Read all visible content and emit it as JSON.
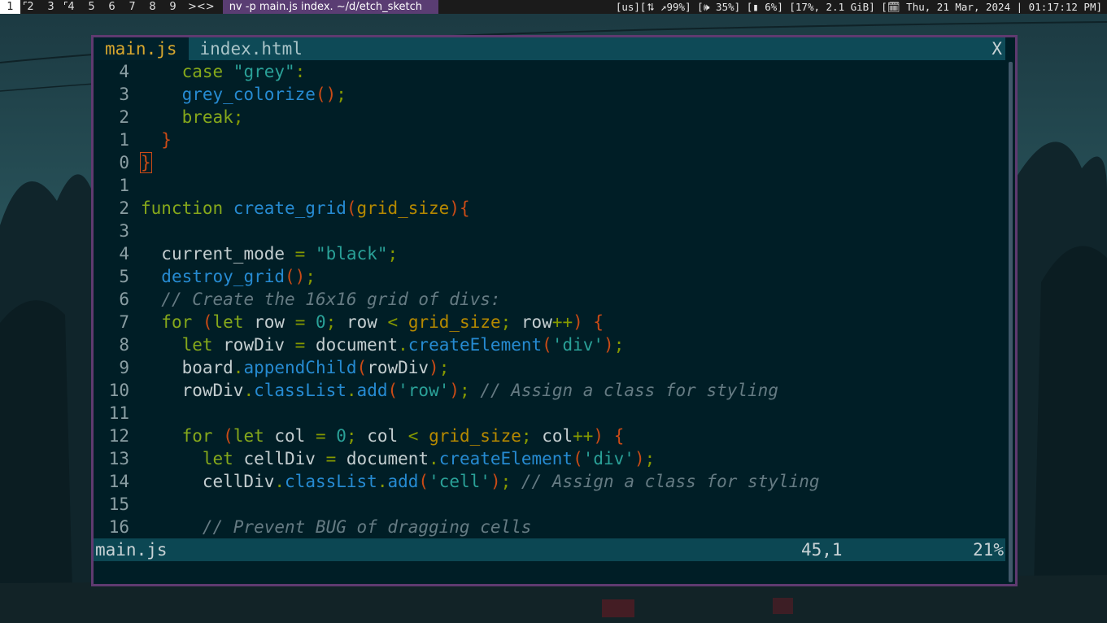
{
  "topbar": {
    "workspaces": [
      "1",
      "2",
      "3",
      "4",
      "5",
      "6",
      "7",
      "8",
      "9"
    ],
    "active_workspace": "1",
    "layout_symbol": "><>",
    "window_title": "nv -p main.js index. ~/d/etch_sketch",
    "status_text": "[us][⮁ ↗99%] [🕪 35%] [▮ 6%] [17%, 2.1 GiB] [🗓 Thu, 21 Mar, 2024 | 01:17:12 PM]"
  },
  "tabs": [
    {
      "label": "main.js",
      "active": true
    },
    {
      "label": "index.html",
      "active": false
    }
  ],
  "tab_close_label": "X",
  "code_lines": [
    {
      "num": "4",
      "indent": 4,
      "tokens": [
        [
          "kw",
          "case "
        ],
        [
          "str",
          "\"grey\""
        ],
        [
          "op",
          ":"
        ]
      ]
    },
    {
      "num": "3",
      "indent": 4,
      "tokens": [
        [
          "fn",
          "grey_colorize"
        ],
        [
          "par",
          "()"
        ],
        [
          "op",
          ";"
        ]
      ]
    },
    {
      "num": "2",
      "indent": 4,
      "tokens": [
        [
          "kw",
          "break"
        ],
        [
          "op",
          ";"
        ]
      ]
    },
    {
      "num": "1",
      "indent": 2,
      "tokens": [
        [
          "par",
          "}"
        ]
      ]
    },
    {
      "num": "0",
      "indent": 0,
      "tokens": [
        [
          "par",
          "}"
        ]
      ],
      "cursor": true
    },
    {
      "num": "1",
      "indent": 0,
      "tokens": []
    },
    {
      "num": "2",
      "indent": 0,
      "tokens": [
        [
          "kw",
          "function "
        ],
        [
          "fn",
          "create_grid"
        ],
        [
          "par",
          "("
        ],
        [
          "var",
          "grid_size"
        ],
        [
          "par",
          "){"
        ]
      ]
    },
    {
      "num": "3",
      "indent": 0,
      "tokens": []
    },
    {
      "num": "4",
      "indent": 2,
      "tokens": [
        [
          "plain",
          "current_mode "
        ],
        [
          "op",
          "= "
        ],
        [
          "str",
          "\"black\""
        ],
        [
          "op",
          ";"
        ]
      ]
    },
    {
      "num": "5",
      "indent": 2,
      "tokens": [
        [
          "fn",
          "destroy_grid"
        ],
        [
          "par",
          "()"
        ],
        [
          "op",
          ";"
        ]
      ]
    },
    {
      "num": "6",
      "indent": 2,
      "tokens": [
        [
          "cm",
          "// Create the 16x16 grid of divs:"
        ]
      ]
    },
    {
      "num": "7",
      "indent": 2,
      "tokens": [
        [
          "kw",
          "for "
        ],
        [
          "par",
          "("
        ],
        [
          "kw",
          "let "
        ],
        [
          "plain",
          "row "
        ],
        [
          "op",
          "= "
        ],
        [
          "num",
          "0"
        ],
        [
          "op",
          "; "
        ],
        [
          "plain",
          "row "
        ],
        [
          "op",
          "< "
        ],
        [
          "var",
          "grid_size"
        ],
        [
          "op",
          "; "
        ],
        [
          "plain",
          "row"
        ],
        [
          "op",
          "++"
        ],
        [
          "par",
          ") {"
        ]
      ]
    },
    {
      "num": "8",
      "indent": 4,
      "tokens": [
        [
          "kw",
          "let "
        ],
        [
          "plain",
          "rowDiv "
        ],
        [
          "op",
          "= "
        ],
        [
          "plain",
          "document"
        ],
        [
          "op",
          "."
        ],
        [
          "fn",
          "createElement"
        ],
        [
          "par",
          "("
        ],
        [
          "str",
          "'div'"
        ],
        [
          "par",
          ")"
        ],
        [
          "op",
          ";"
        ]
      ]
    },
    {
      "num": "9",
      "indent": 4,
      "tokens": [
        [
          "plain",
          "board"
        ],
        [
          "op",
          "."
        ],
        [
          "fn",
          "appendChild"
        ],
        [
          "par",
          "("
        ],
        [
          "plain",
          "rowDiv"
        ],
        [
          "par",
          ")"
        ],
        [
          "op",
          ";"
        ]
      ]
    },
    {
      "num": "10",
      "indent": 4,
      "tokens": [
        [
          "plain",
          "rowDiv"
        ],
        [
          "op",
          "."
        ],
        [
          "fn",
          "classList"
        ],
        [
          "op",
          "."
        ],
        [
          "fn",
          "add"
        ],
        [
          "par",
          "("
        ],
        [
          "str",
          "'row'"
        ],
        [
          "par",
          ")"
        ],
        [
          "op",
          "; "
        ],
        [
          "cm",
          "// Assign a class for styling"
        ]
      ]
    },
    {
      "num": "11",
      "indent": 0,
      "tokens": []
    },
    {
      "num": "12",
      "indent": 4,
      "tokens": [
        [
          "kw",
          "for "
        ],
        [
          "par",
          "("
        ],
        [
          "kw",
          "let "
        ],
        [
          "plain",
          "col "
        ],
        [
          "op",
          "= "
        ],
        [
          "num",
          "0"
        ],
        [
          "op",
          "; "
        ],
        [
          "plain",
          "col "
        ],
        [
          "op",
          "< "
        ],
        [
          "var",
          "grid_size"
        ],
        [
          "op",
          "; "
        ],
        [
          "plain",
          "col"
        ],
        [
          "op",
          "++"
        ],
        [
          "par",
          ") {"
        ]
      ]
    },
    {
      "num": "13",
      "indent": 6,
      "tokens": [
        [
          "kw",
          "let "
        ],
        [
          "plain",
          "cellDiv "
        ],
        [
          "op",
          "= "
        ],
        [
          "plain",
          "document"
        ],
        [
          "op",
          "."
        ],
        [
          "fn",
          "createElement"
        ],
        [
          "par",
          "("
        ],
        [
          "str",
          "'div'"
        ],
        [
          "par",
          ")"
        ],
        [
          "op",
          ";"
        ]
      ]
    },
    {
      "num": "14",
      "indent": 6,
      "tokens": [
        [
          "plain",
          "cellDiv"
        ],
        [
          "op",
          "."
        ],
        [
          "fn",
          "classList"
        ],
        [
          "op",
          "."
        ],
        [
          "fn",
          "add"
        ],
        [
          "par",
          "("
        ],
        [
          "str",
          "'cell'"
        ],
        [
          "par",
          ")"
        ],
        [
          "op",
          "; "
        ],
        [
          "cm",
          "// Assign a class for styling"
        ]
      ]
    },
    {
      "num": "15",
      "indent": 0,
      "tokens": []
    },
    {
      "num": "16",
      "indent": 6,
      "tokens": [
        [
          "cm",
          "// Prevent BUG of dragging cells"
        ]
      ]
    }
  ],
  "statusline": {
    "file": "main.js",
    "position": "45,1",
    "percent": "21%"
  }
}
